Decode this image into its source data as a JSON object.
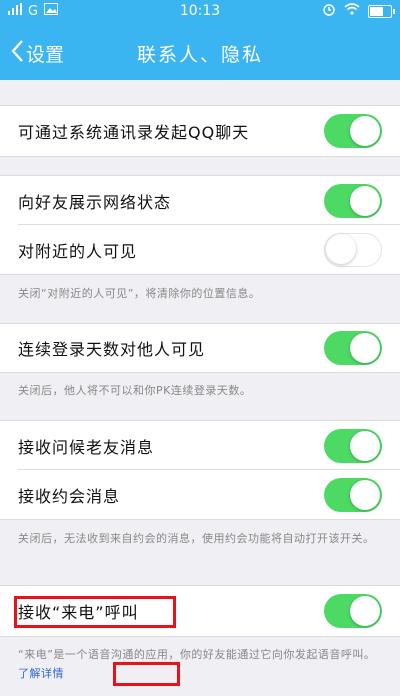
{
  "status_bar": {
    "carrier": "G",
    "time": "10:13"
  },
  "nav": {
    "back_label": "设置",
    "title": "联系人、隐私"
  },
  "rows": [
    {
      "label": "可通过系统通讯录发起QQ聊天",
      "on": true
    },
    {
      "label": "向好友展示网络状态",
      "on": true
    },
    {
      "label": "对附近的人可见",
      "on": false
    },
    {
      "label": "连续登录天数对他人可见",
      "on": true
    },
    {
      "label": "接收问候老友消息",
      "on": true
    },
    {
      "label": "接收约会消息",
      "on": true
    },
    {
      "label": "接收“来电”呼叫",
      "on": true
    }
  ],
  "notes": {
    "nearby": "关闭“对附近的人可见”，将清除你的位置信息。",
    "login_days": "关闭后，他人将不可以和你PK连续登录天数。",
    "dating": "关闭后，无法收到来自约会的消息，使用约会功能将自动打开该开关。",
    "call": "“来电”是一个语音沟通的应用，你的好友能通过它向你发起语音呼叫。",
    "call_link": "了解详情"
  },
  "colors": {
    "accent": "#3bb4f2",
    "toggle_on": "#4cd964",
    "highlight": "#e8131a",
    "link": "#2f67d8"
  }
}
